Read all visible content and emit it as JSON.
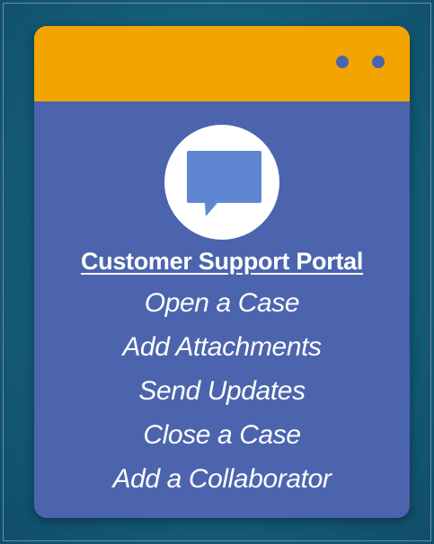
{
  "portal": {
    "title": "Customer Support Portal",
    "menu_items": [
      {
        "label": "Open a Case"
      },
      {
        "label": "Add Attachments"
      },
      {
        "label": "Send Updates"
      },
      {
        "label": "Close a Case"
      },
      {
        "label": "Add a Collaborator"
      }
    ],
    "icon": "chat-bubble-icon"
  },
  "colors": {
    "background": "#17617f",
    "card": "#4b64ad",
    "titlebar": "#f2a400",
    "icon_circle": "#ffffff",
    "icon_bubble": "#5f86d2",
    "text": "#ffffff"
  }
}
